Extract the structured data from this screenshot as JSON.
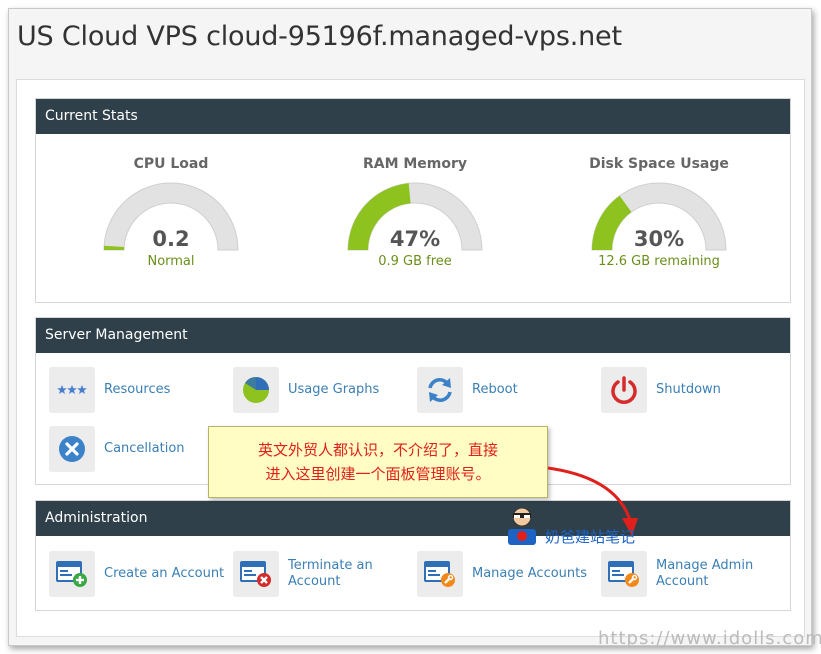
{
  "page_title": "US Cloud VPS cloud-95196f.managed-vps.net",
  "stats": {
    "header": "Current Stats",
    "gauges": [
      {
        "title": "CPU Load",
        "value": "0.2",
        "subtitle": "Normal",
        "fill": 0.02,
        "color": "#8dc21f"
      },
      {
        "title": "RAM Memory",
        "value": "47%",
        "subtitle": "0.9 GB free",
        "fill": 0.47,
        "color": "#8dc21f"
      },
      {
        "title": "Disk Space Usage",
        "value": "30%",
        "subtitle": "12.6 GB remaining",
        "fill": 0.3,
        "color": "#8dc21f"
      }
    ]
  },
  "management": {
    "header": "Server Management",
    "items": [
      {
        "label": "Resources",
        "icon": "stars-icon"
      },
      {
        "label": "Usage Graphs",
        "icon": "pie-chart-icon"
      },
      {
        "label": "Reboot",
        "icon": "refresh-icon"
      },
      {
        "label": "Shutdown",
        "icon": "power-icon"
      },
      {
        "label": "Cancellation",
        "icon": "close-circle-icon"
      }
    ]
  },
  "administration": {
    "header": "Administration",
    "items": [
      {
        "label": "Create an Account",
        "icon": "window-add-icon"
      },
      {
        "label": "Terminate an Account",
        "icon": "window-remove-icon"
      },
      {
        "label": "Manage Accounts",
        "icon": "window-wrench-icon"
      },
      {
        "label": "Manage Admin Account",
        "icon": "window-wrench-icon"
      }
    ]
  },
  "annotation": {
    "line1": "英文外贸人都认识，不介绍了，直接",
    "line2": "进入这里创建一个面板管理账号。",
    "watermark": "奶爸建站笔记",
    "url": "https://www.idolls.com"
  },
  "colors": {
    "header_bg": "#2f404b",
    "link": "#3a7fb5",
    "gauge_fill": "#8dc21f",
    "gauge_track": "#e2e2e2",
    "accent_red": "#e0201a"
  }
}
